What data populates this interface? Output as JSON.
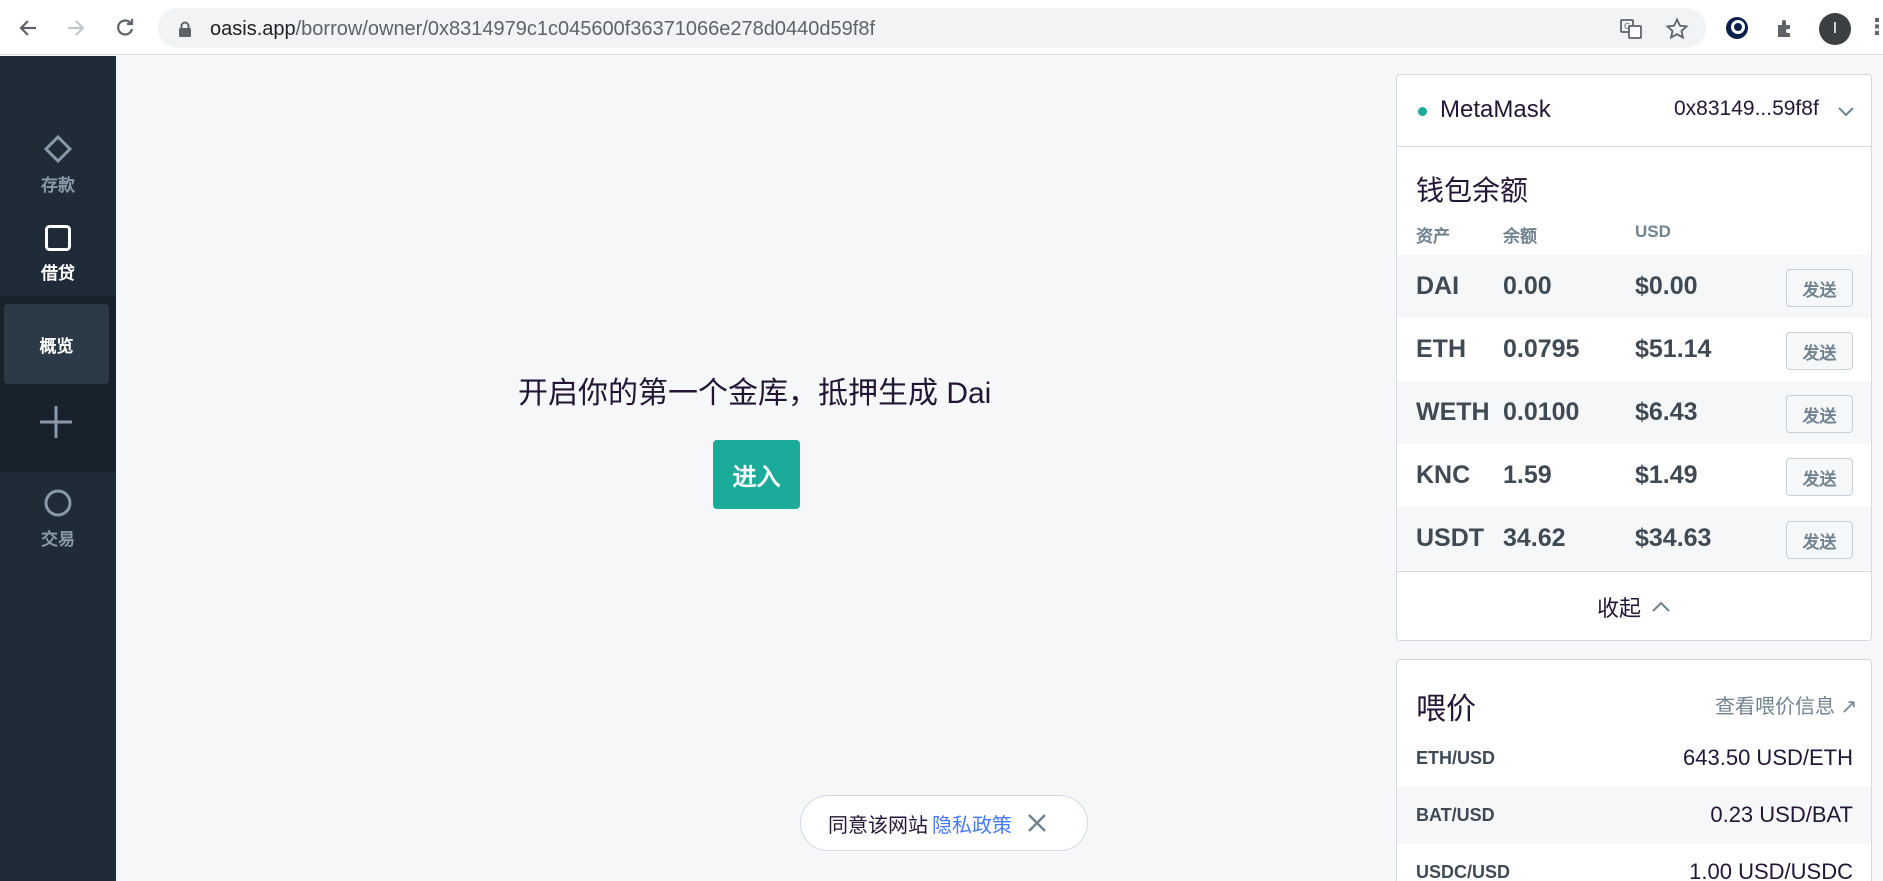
{
  "browser": {
    "url_host": "oasis.app",
    "url_path": "/borrow/owner/0x8314979c1c045600f36371066e278d0440d59f8f",
    "profile_initial": "I"
  },
  "sidebar": {
    "items": [
      {
        "label": "存款",
        "icon": "diamond-icon"
      },
      {
        "label": "借贷",
        "icon": "square-icon"
      },
      {
        "label": "交易",
        "icon": "circle-icon"
      }
    ],
    "sub_items": [
      {
        "label": "概览"
      }
    ]
  },
  "main": {
    "cta_text": "开启你的第一个金库，抵押生成 Dai",
    "cta_button": "进入"
  },
  "cookie": {
    "text": "同意该网站",
    "link": "隐私政策"
  },
  "wallet": {
    "provider": "MetaMask",
    "address": "0x83149...59f8f",
    "title": "钱包余额",
    "headers": {
      "asset": "资产",
      "balance": "余额",
      "usd": "USD"
    },
    "rows": [
      {
        "asset": "DAI",
        "balance": "0.00",
        "usd": "$0.00",
        "action": "发送"
      },
      {
        "asset": "ETH",
        "balance": "0.0795",
        "usd": "$51.14",
        "action": "发送"
      },
      {
        "asset": "WETH",
        "balance": "0.0100",
        "usd": "$6.43",
        "action": "发送"
      },
      {
        "asset": "KNC",
        "balance": "1.59",
        "usd": "$1.49",
        "action": "发送"
      },
      {
        "asset": "USDT",
        "balance": "34.62",
        "usd": "$34.63",
        "action": "发送"
      }
    ],
    "collapse_label": "收起"
  },
  "oracle": {
    "title": "喂价",
    "link": "查看喂价信息 ↗",
    "rows": [
      {
        "pair": "ETH/USD",
        "value": "643.50 USD/ETH"
      },
      {
        "pair": "BAT/USD",
        "value": "0.23 USD/BAT"
      },
      {
        "pair": "USDC/USD",
        "value": "1.00 USD/USDC"
      }
    ]
  },
  "colors": {
    "accent": "#1aab9b",
    "sidebar": "#1f2b37",
    "link": "#447afb"
  }
}
